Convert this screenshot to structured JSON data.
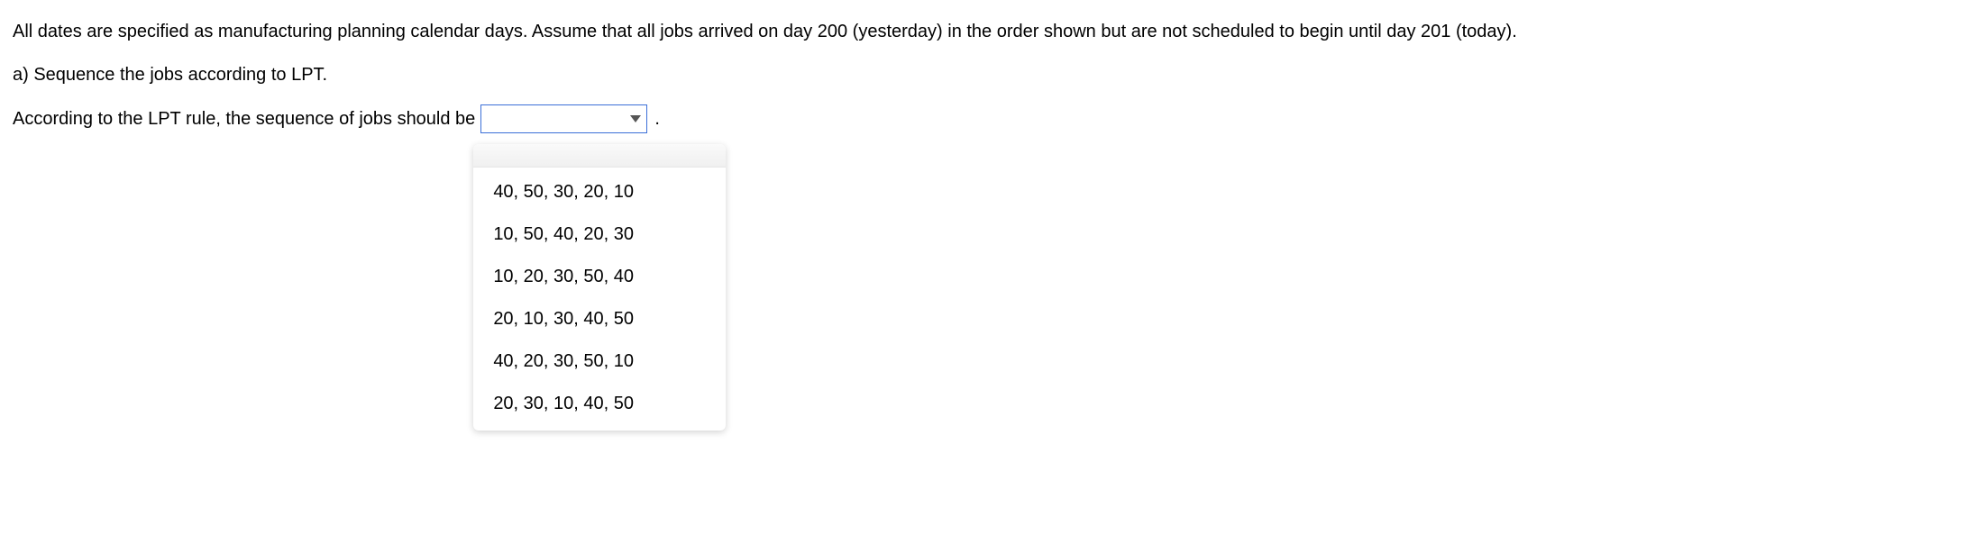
{
  "intro_text": "All dates are specified as manufacturing planning calendar days. Assume that all jobs arrived on day 200 (yesterday) in the order shown but are not scheduled to begin until day 201 (today).",
  "part_a": "a) Sequence the jobs according to LPT.",
  "prompt_text": "According to the LPT rule, the sequence of jobs should be",
  "period": ".",
  "dropdown": {
    "selected": "",
    "options": [
      "40, 50, 30, 20, 10",
      "10, 50, 40, 20, 30",
      "10, 20, 30, 50, 40",
      "20, 10, 30, 40, 50",
      "40, 20, 30, 50, 10",
      "20, 30, 10, 40, 50"
    ]
  }
}
